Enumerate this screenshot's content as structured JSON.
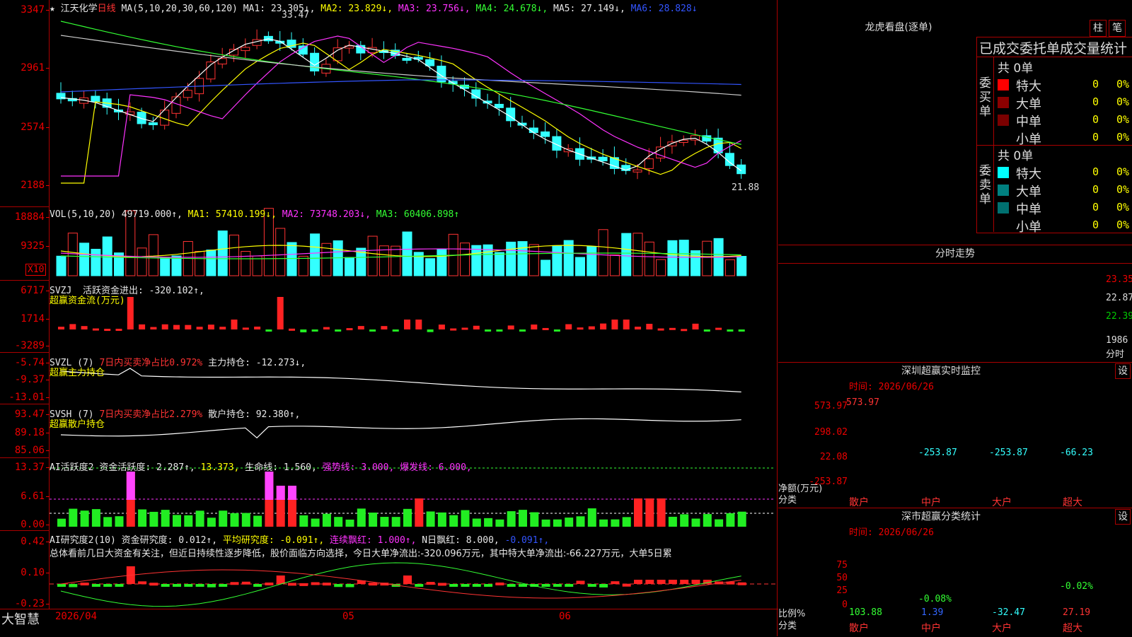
{
  "header": {
    "stock_name": "江天化学",
    "period": "日线",
    "ma_label": "MA(5,10,20,30,60,120)",
    "ma1": "MA1: 23.305↓,",
    "ma2": "MA2: 23.829↓,",
    "ma3": "MA3: 23.756↓,",
    "ma4": "MA4: 24.678↓,",
    "ma5": "MA5: 27.149↓,",
    "ma6": "MA6: 28.828↓"
  },
  "price_axis": [
    "3347",
    "2961",
    "2574",
    "2188"
  ],
  "price_annot": {
    "high": "33.47",
    "low": "21.88"
  },
  "vol": {
    "label": "VOL(5,10,20)",
    "value": "49719.000↑,",
    "ma1": "MA1: 57410.199↓,",
    "ma2": "MA2: 73748.203↓,",
    "ma3": "MA3: 60406.898↑",
    "axis": [
      "18884",
      "9325"
    ],
    "unit": "X10"
  },
  "svzj": {
    "label": "SVZJ",
    "desc": "活跃资金进出: -320.102↑,",
    "sub": "超赢资金流(万元)",
    "axis": [
      "6717",
      "1714",
      "-3289"
    ]
  },
  "svzl": {
    "label": "SVZL (7)",
    "desc1": "7日内买卖净占比0.972%",
    "desc2": "主力持仓: -12.273↓,",
    "sub": "超赢主力持仓",
    "axis": [
      "-5.74",
      "-9.37",
      "-13.01"
    ]
  },
  "svsh": {
    "label": "SVSH (7)",
    "desc1": "7日内买卖净占比2.279%",
    "desc2": "散户持仓: 92.380↑,",
    "sub": "超赢散户持仓",
    "axis": [
      "93.47",
      "89.18",
      "85.06"
    ]
  },
  "ai_active": {
    "label": "AI活跃度2",
    "desc1": "资金活跃度: 2.287↑,",
    "desc2": "13.373,",
    "desc3": "生命线: 1.560,",
    "desc4": "强势线: 3.000,",
    "desc5": "爆发线: 6.000,",
    "axis": [
      "13.37",
      "6.61",
      "0.00"
    ]
  },
  "ai_research": {
    "label": "AI研究度2(10)",
    "desc1": "资金研究度: 0.012↑,",
    "desc2": "平均研究度: -0.091↑,",
    "desc3": "连续飘红: 1.000↑,",
    "desc4": "N日飘红: 8.000,",
    "desc5": "-0.091↑,",
    "summary": "总体看前几日大资金有关注，但近日持续性逐步降低，股价面临方向选择，今日大单净流出:-320.096万元，其中特大单净流出:-66.227万元，大单5日累",
    "axis": [
      "0.42",
      "0.10",
      "-0.23"
    ]
  },
  "xaxis": {
    "d1": "2026/04",
    "d2": "05",
    "d3": "06"
  },
  "footer_logo": "大智慧",
  "longhu": {
    "title": "龙虎看盘(逐单)",
    "btn_zhu": "柱",
    "btn_bi": "笔",
    "section_title": "已成交委托单成交量统计",
    "buy_label": "委买单",
    "sell_label": "委卖单",
    "buy_total": "共 0单",
    "sell_total": "共 0单",
    "rows": [
      "特大",
      "大单",
      "中单",
      "小单"
    ],
    "count": "0",
    "pct": "0%",
    "buy_colors": [
      "#ff0000",
      "#8b0000",
      "#7a0000",
      "#000000"
    ],
    "sell_colors": [
      "#00ffff",
      "#008080",
      "#007070",
      "#000000"
    ]
  },
  "fenshi": {
    "title": "分时走势",
    "axis": [
      "23.35",
      "22.87",
      "22.39",
      "1986",
      "分时"
    ]
  },
  "sz_monitor": {
    "title": "深圳超赢实时监控",
    "btn": "设",
    "time": "时间: 2026/06/26",
    "axis": [
      "573.97",
      "298.02",
      "22.08",
      "-253.87"
    ],
    "unit1": "净额(万元)",
    "unit2": "分类",
    "bars": [
      {
        "label": "散户",
        "value": "573.97",
        "num": 573.97
      },
      {
        "label": "中户",
        "value": "-253.87",
        "num": -253.87
      },
      {
        "label": "大户",
        "value": "-253.87",
        "num": -253.87
      },
      {
        "label": "超大",
        "value": "-66.23",
        "num": -66.23
      }
    ]
  },
  "sz_class": {
    "title": "深市超赢分类统计",
    "btn": "设",
    "time": "时间: 2026/06/26",
    "axis": [
      "75",
      "50",
      "25",
      "0"
    ],
    "unit1": "比例%",
    "unit2": "分类",
    "bars": [
      {
        "label": "散户",
        "top": "",
        "bottom": "103.88",
        "num": 103.88
      },
      {
        "label": "中户",
        "top": "-0.08%",
        "bottom": "1.39",
        "num": 1.39
      },
      {
        "label": "大户",
        "top": "",
        "bottom": "-32.47",
        "num": -32.47
      },
      {
        "label": "超大",
        "top": "-0.02%",
        "bottom": "27.19",
        "num": 27.19
      }
    ]
  }
}
